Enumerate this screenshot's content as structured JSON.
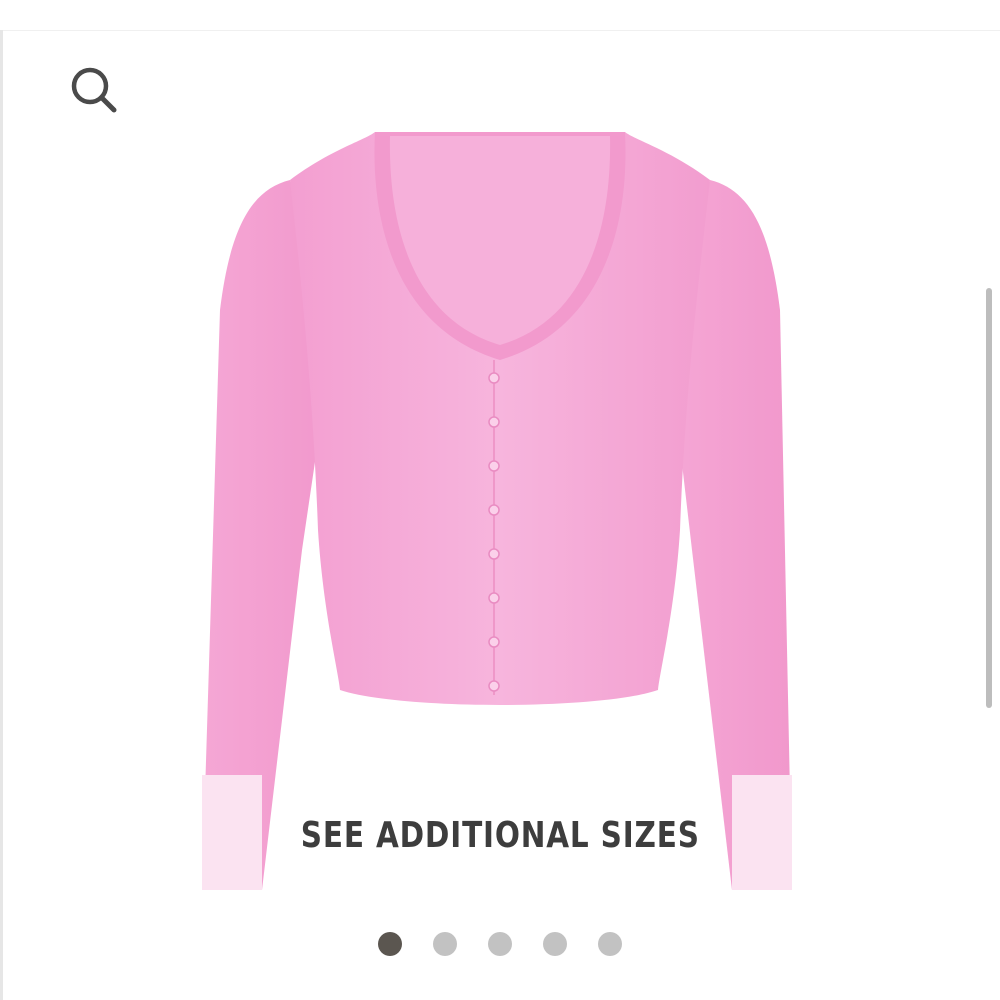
{
  "search": {
    "icon": "search-icon"
  },
  "product": {
    "image_description_icon": "pink-long-sleeve-cardigan-image",
    "color": "#f4a9d6"
  },
  "sizes_banner": {
    "label": "SEE ADDITIONAL SIZES"
  },
  "carousel": {
    "total": 5,
    "active_index": 0,
    "active_color": "#5b5650",
    "inactive_color": "#c2c2c2"
  }
}
